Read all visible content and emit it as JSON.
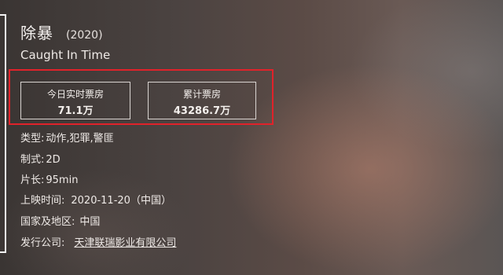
{
  "movie": {
    "title": "除暴",
    "year": "(2020)",
    "english_title": "Caught In Time"
  },
  "box_office": {
    "today_label": "今日实时票房",
    "today_value": "71.1万",
    "total_label": "累计票房",
    "total_value": "43286.7万"
  },
  "details": {
    "genre_label": "类型:",
    "genre_value": "动作,犯罪,警匪",
    "format_label": "制式:",
    "format_value": "2D",
    "length_label": "片长:",
    "length_value": "95min",
    "release_label": "上映时间:",
    "release_value": "2020-11-20（中国）",
    "region_label": "国家及地区:",
    "region_value": "中国",
    "distributor_label": "发行公司:",
    "distributor_value": "天津联瑞影业有限公司"
  },
  "colors": {
    "highlight_border": "#e1222a"
  }
}
